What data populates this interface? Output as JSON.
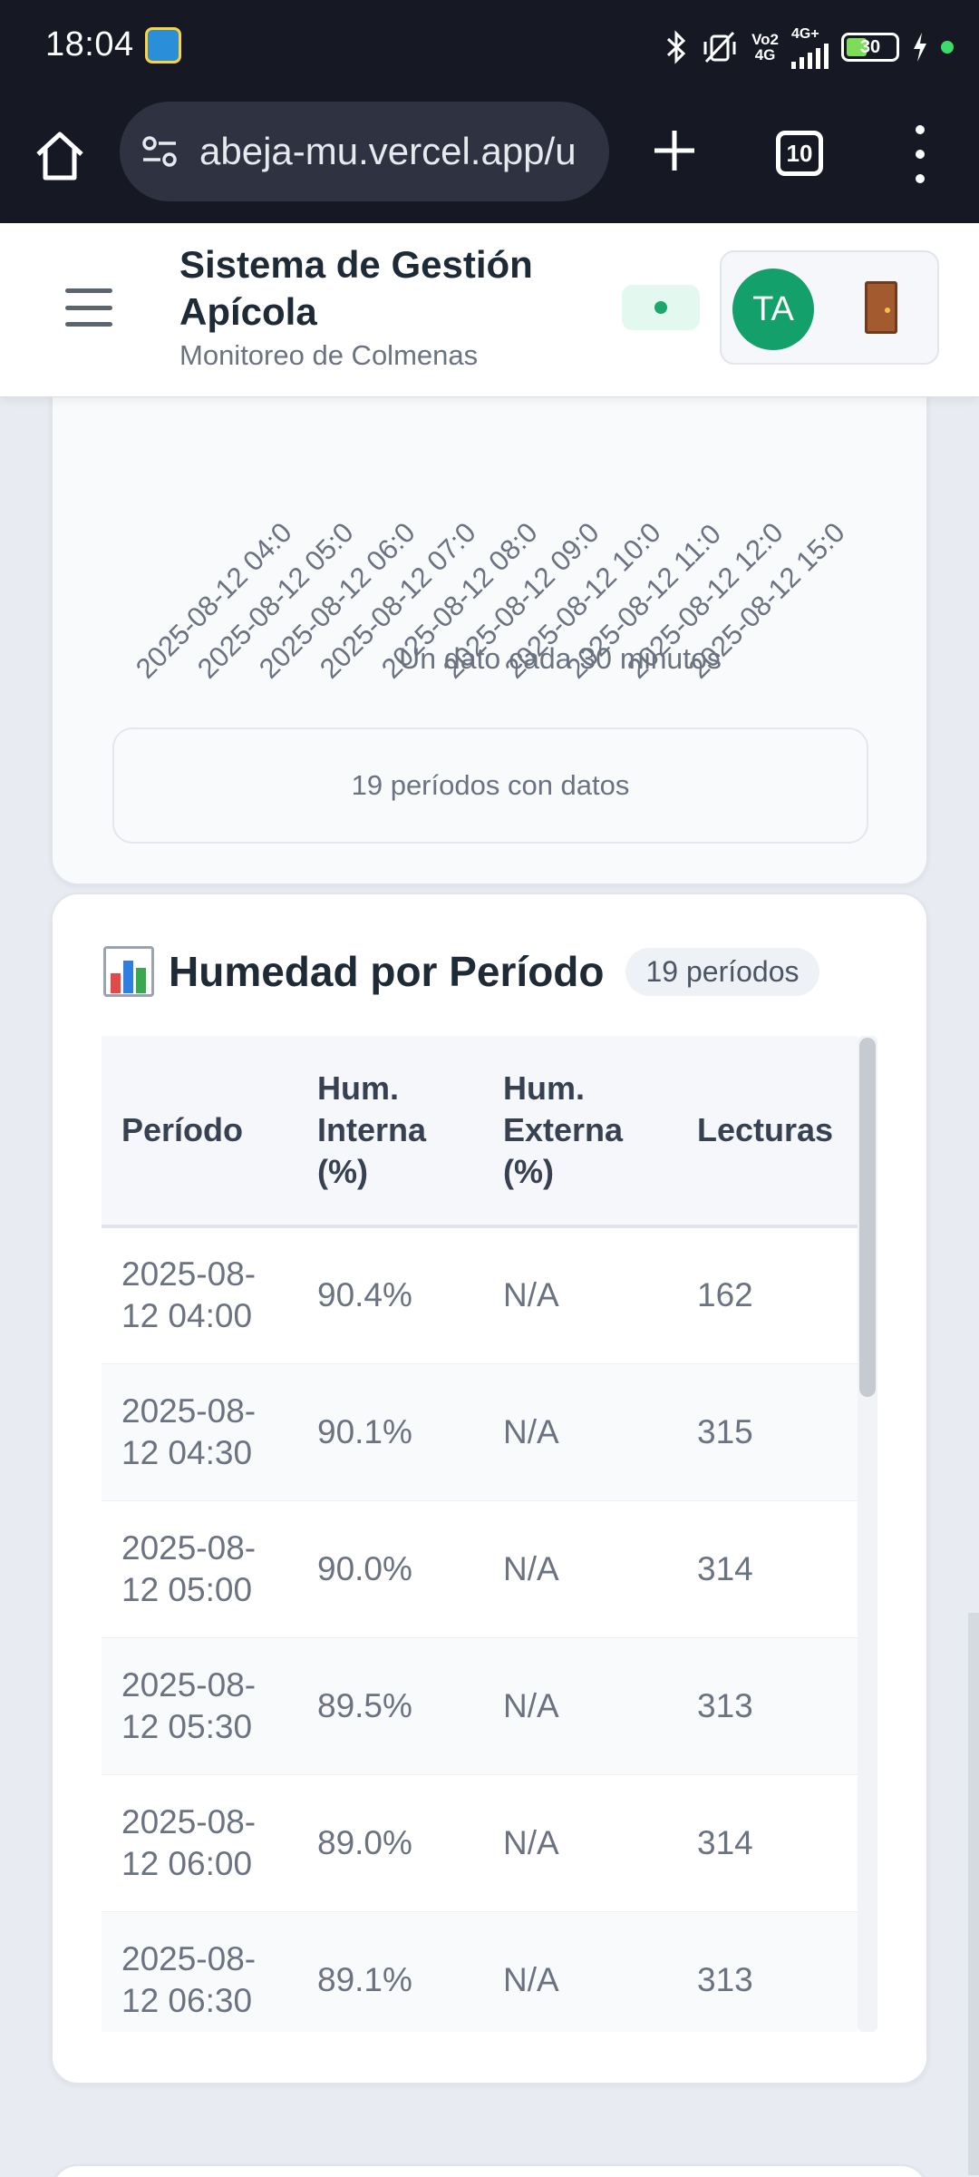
{
  "status_bar": {
    "time": "18:04",
    "network_label_top": "Vo2",
    "network_label_bottom": "4G",
    "network_type": "4G+",
    "battery_level": "30",
    "icons": [
      "app-icon",
      "bluetooth-icon",
      "vibrate-off-icon",
      "signal-icon",
      "battery-icon",
      "charging-icon"
    ]
  },
  "browser": {
    "url": "abeja-mu.vercel.app/u",
    "tab_count": "10",
    "icons": [
      "home-icon",
      "site-settings-icon",
      "new-tab-icon",
      "tabs-icon",
      "more-menu-icon"
    ]
  },
  "header": {
    "title": "Sistema de Gestión Apícola",
    "subtitle": "Monitoreo de Colmenas",
    "avatar_initials": "TA",
    "status_color": "#1ea76a",
    "avatar_color": "#14a06a"
  },
  "chart_section": {
    "chart_data": {
      "type": "line",
      "x_tick_labels": [
        "2025-08-12 04:0",
        "2025-08-12 05:0",
        "2025-08-12 06:0",
        "2025-08-12 07:0",
        "2025-08-12 08:0",
        "2025-08-12 09:0",
        "2025-08-12 10:0",
        "2025-08-12 11:0",
        "2025-08-12 12:0",
        "2025-08-12 15:0"
      ],
      "xlabel": "Un dato cada 30 minutos"
    },
    "periods_note": "19 períodos con datos"
  },
  "table_section": {
    "title": "Humedad por Período",
    "count_badge": "19 períodos",
    "columns": [
      "Período",
      "Hum. Interna (%)",
      "Hum. Externa (%)",
      "Lecturas"
    ],
    "rows": [
      {
        "period": "2025-08-12 04:00",
        "internal": "90.4%",
        "external": "N/A",
        "readings": "162"
      },
      {
        "period": "2025-08-12 04:30",
        "internal": "90.1%",
        "external": "N/A",
        "readings": "315"
      },
      {
        "period": "2025-08-12 05:00",
        "internal": "90.0%",
        "external": "N/A",
        "readings": "314"
      },
      {
        "period": "2025-08-12 05:30",
        "internal": "89.5%",
        "external": "N/A",
        "readings": "313"
      },
      {
        "period": "2025-08-12 06:00",
        "internal": "89.0%",
        "external": "N/A",
        "readings": "314"
      },
      {
        "period": "2025-08-12 06:30",
        "internal": "89.1%",
        "external": "N/A",
        "readings": "313"
      }
    ]
  }
}
